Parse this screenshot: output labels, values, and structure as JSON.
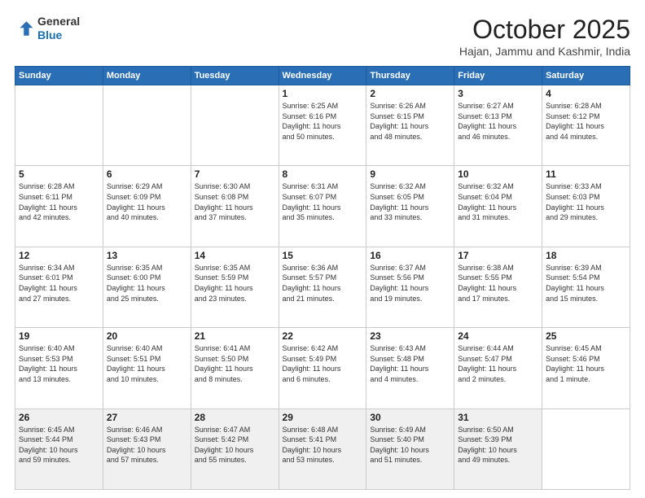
{
  "header": {
    "logo_general": "General",
    "logo_blue": "Blue",
    "month": "October 2025",
    "location": "Hajan, Jammu and Kashmir, India"
  },
  "days_of_week": [
    "Sunday",
    "Monday",
    "Tuesday",
    "Wednesday",
    "Thursday",
    "Friday",
    "Saturday"
  ],
  "weeks": [
    [
      {
        "num": "",
        "info": ""
      },
      {
        "num": "",
        "info": ""
      },
      {
        "num": "",
        "info": ""
      },
      {
        "num": "1",
        "info": "Sunrise: 6:25 AM\nSunset: 6:16 PM\nDaylight: 11 hours\nand 50 minutes."
      },
      {
        "num": "2",
        "info": "Sunrise: 6:26 AM\nSunset: 6:15 PM\nDaylight: 11 hours\nand 48 minutes."
      },
      {
        "num": "3",
        "info": "Sunrise: 6:27 AM\nSunset: 6:13 PM\nDaylight: 11 hours\nand 46 minutes."
      },
      {
        "num": "4",
        "info": "Sunrise: 6:28 AM\nSunset: 6:12 PM\nDaylight: 11 hours\nand 44 minutes."
      }
    ],
    [
      {
        "num": "5",
        "info": "Sunrise: 6:28 AM\nSunset: 6:11 PM\nDaylight: 11 hours\nand 42 minutes."
      },
      {
        "num": "6",
        "info": "Sunrise: 6:29 AM\nSunset: 6:09 PM\nDaylight: 11 hours\nand 40 minutes."
      },
      {
        "num": "7",
        "info": "Sunrise: 6:30 AM\nSunset: 6:08 PM\nDaylight: 11 hours\nand 37 minutes."
      },
      {
        "num": "8",
        "info": "Sunrise: 6:31 AM\nSunset: 6:07 PM\nDaylight: 11 hours\nand 35 minutes."
      },
      {
        "num": "9",
        "info": "Sunrise: 6:32 AM\nSunset: 6:05 PM\nDaylight: 11 hours\nand 33 minutes."
      },
      {
        "num": "10",
        "info": "Sunrise: 6:32 AM\nSunset: 6:04 PM\nDaylight: 11 hours\nand 31 minutes."
      },
      {
        "num": "11",
        "info": "Sunrise: 6:33 AM\nSunset: 6:03 PM\nDaylight: 11 hours\nand 29 minutes."
      }
    ],
    [
      {
        "num": "12",
        "info": "Sunrise: 6:34 AM\nSunset: 6:01 PM\nDaylight: 11 hours\nand 27 minutes."
      },
      {
        "num": "13",
        "info": "Sunrise: 6:35 AM\nSunset: 6:00 PM\nDaylight: 11 hours\nand 25 minutes."
      },
      {
        "num": "14",
        "info": "Sunrise: 6:35 AM\nSunset: 5:59 PM\nDaylight: 11 hours\nand 23 minutes."
      },
      {
        "num": "15",
        "info": "Sunrise: 6:36 AM\nSunset: 5:57 PM\nDaylight: 11 hours\nand 21 minutes."
      },
      {
        "num": "16",
        "info": "Sunrise: 6:37 AM\nSunset: 5:56 PM\nDaylight: 11 hours\nand 19 minutes."
      },
      {
        "num": "17",
        "info": "Sunrise: 6:38 AM\nSunset: 5:55 PM\nDaylight: 11 hours\nand 17 minutes."
      },
      {
        "num": "18",
        "info": "Sunrise: 6:39 AM\nSunset: 5:54 PM\nDaylight: 11 hours\nand 15 minutes."
      }
    ],
    [
      {
        "num": "19",
        "info": "Sunrise: 6:40 AM\nSunset: 5:53 PM\nDaylight: 11 hours\nand 13 minutes."
      },
      {
        "num": "20",
        "info": "Sunrise: 6:40 AM\nSunset: 5:51 PM\nDaylight: 11 hours\nand 10 minutes."
      },
      {
        "num": "21",
        "info": "Sunrise: 6:41 AM\nSunset: 5:50 PM\nDaylight: 11 hours\nand 8 minutes."
      },
      {
        "num": "22",
        "info": "Sunrise: 6:42 AM\nSunset: 5:49 PM\nDaylight: 11 hours\nand 6 minutes."
      },
      {
        "num": "23",
        "info": "Sunrise: 6:43 AM\nSunset: 5:48 PM\nDaylight: 11 hours\nand 4 minutes."
      },
      {
        "num": "24",
        "info": "Sunrise: 6:44 AM\nSunset: 5:47 PM\nDaylight: 11 hours\nand 2 minutes."
      },
      {
        "num": "25",
        "info": "Sunrise: 6:45 AM\nSunset: 5:46 PM\nDaylight: 11 hours\nand 1 minute."
      }
    ],
    [
      {
        "num": "26",
        "info": "Sunrise: 6:45 AM\nSunset: 5:44 PM\nDaylight: 10 hours\nand 59 minutes."
      },
      {
        "num": "27",
        "info": "Sunrise: 6:46 AM\nSunset: 5:43 PM\nDaylight: 10 hours\nand 57 minutes."
      },
      {
        "num": "28",
        "info": "Sunrise: 6:47 AM\nSunset: 5:42 PM\nDaylight: 10 hours\nand 55 minutes."
      },
      {
        "num": "29",
        "info": "Sunrise: 6:48 AM\nSunset: 5:41 PM\nDaylight: 10 hours\nand 53 minutes."
      },
      {
        "num": "30",
        "info": "Sunrise: 6:49 AM\nSunset: 5:40 PM\nDaylight: 10 hours\nand 51 minutes."
      },
      {
        "num": "31",
        "info": "Sunrise: 6:50 AM\nSunset: 5:39 PM\nDaylight: 10 hours\nand 49 minutes."
      },
      {
        "num": "",
        "info": ""
      }
    ]
  ]
}
